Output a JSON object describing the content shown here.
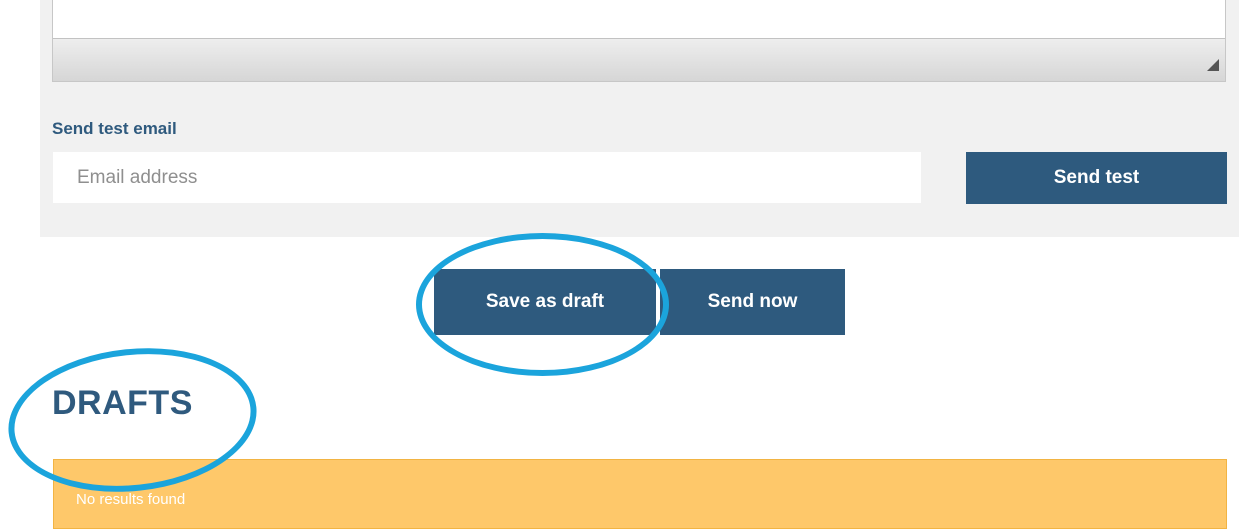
{
  "test_email": {
    "label": "Send test email",
    "input_value": "",
    "input_placeholder": "Email address",
    "send_test_label": "Send test"
  },
  "actions": {
    "save_draft_label": "Save as draft",
    "send_now_label": "Send now"
  },
  "drafts": {
    "heading": "DRAFTS",
    "empty_message": "No results found"
  },
  "colors": {
    "primary": "#2e5a7e",
    "panel_bg": "#f1f1f1",
    "warning_bg": "#fec86a",
    "annotation": "#1ba4dc"
  },
  "annotations": {
    "count": 2,
    "shape": "ellipse",
    "targets": [
      "Save as draft",
      "DRAFTS"
    ]
  }
}
